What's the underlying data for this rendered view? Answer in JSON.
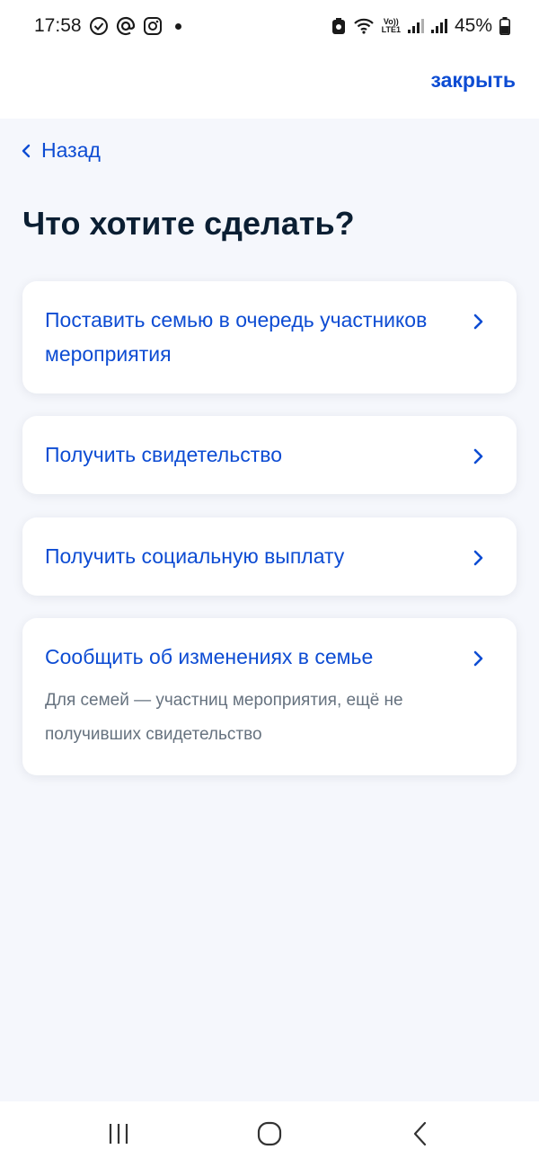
{
  "status_bar": {
    "time": "17:58",
    "battery": "45%",
    "lte_top": "Vo))",
    "lte_bottom": "LTE1",
    "icons": [
      "check-circle-icon",
      "at-icon",
      "instagram-icon",
      "dot-icon",
      "battery-saver-icon",
      "wifi-icon",
      "signal-icon",
      "battery-icon"
    ]
  },
  "header": {
    "close_label": "закрыть"
  },
  "back": {
    "label": "Назад"
  },
  "page": {
    "title": "Что хотите сделать?"
  },
  "options": [
    {
      "title": "Поставить семью в очередь участников мероприятия"
    },
    {
      "title": "Получить свидетельство"
    },
    {
      "title": "Получить социальную выплату"
    },
    {
      "title": "Сообщить об изменениях в семье",
      "description": "Для семей — участниц мероприятия, ещё не получивших свидетельство"
    }
  ],
  "colors": {
    "accent": "#0d4cd3",
    "title": "#0b1f33",
    "secondary_text": "#66727f",
    "background": "#f5f7fc"
  }
}
